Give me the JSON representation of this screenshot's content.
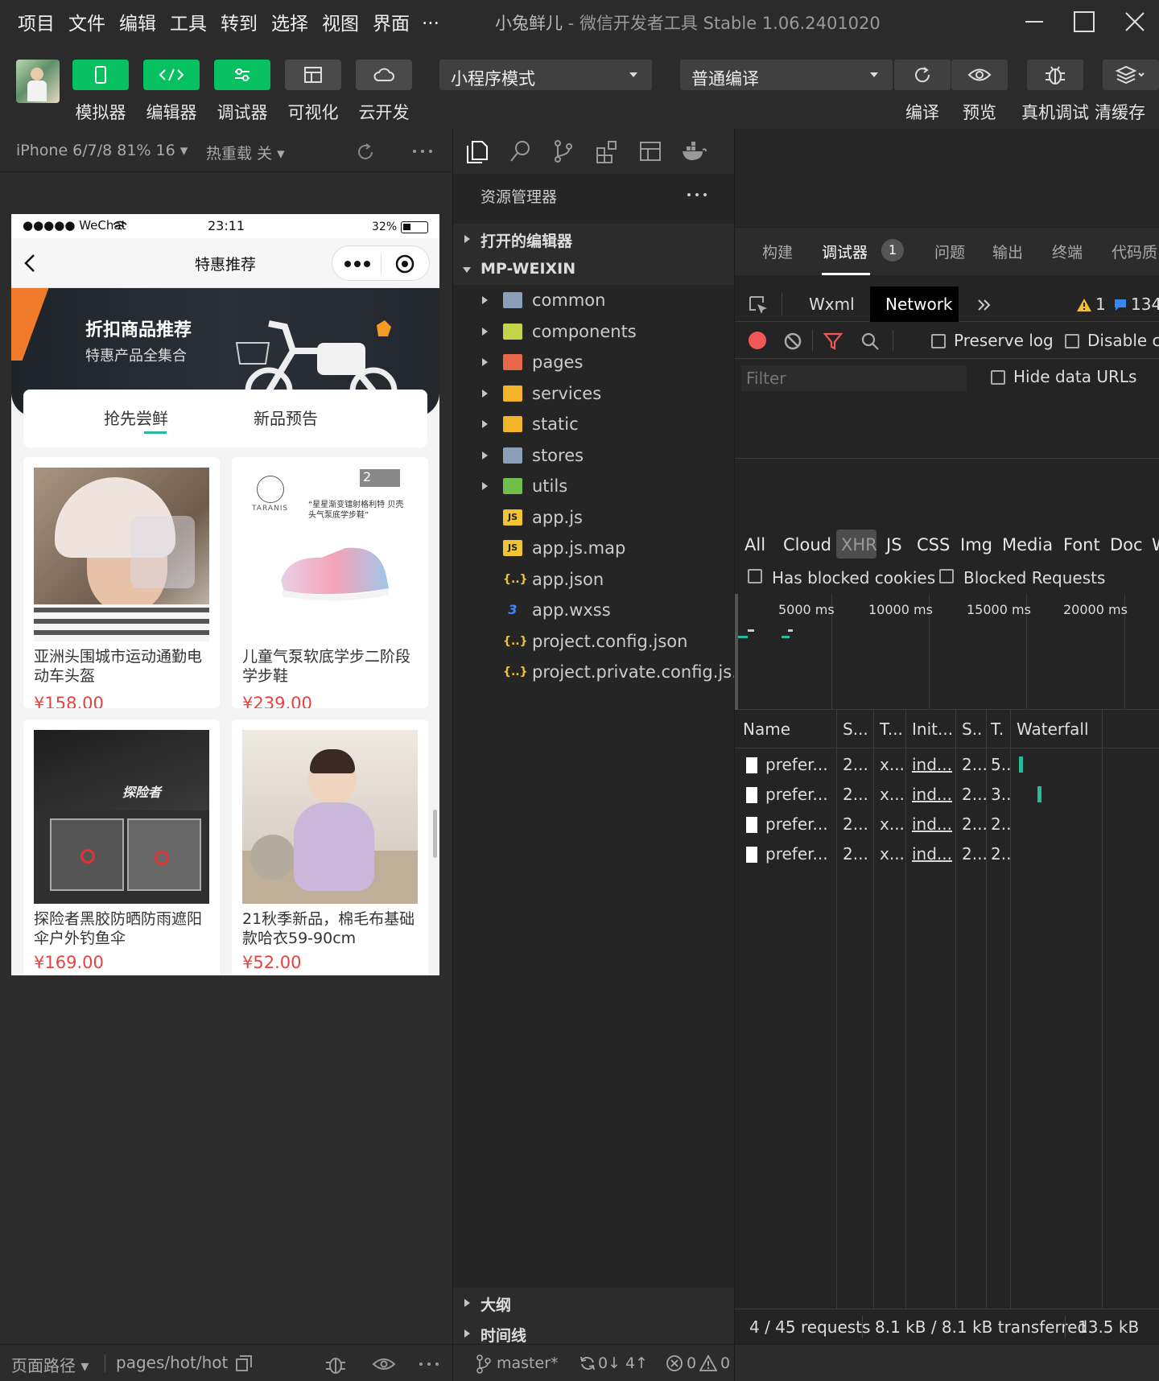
{
  "menu": [
    "项目",
    "文件",
    "编辑",
    "工具",
    "转到",
    "选择",
    "视图",
    "界面",
    "..."
  ],
  "window_title": {
    "app": "小兔鲜儿",
    "sep": " - ",
    "rest": "微信开发者工具 Stable 1.06.2401020"
  },
  "toolbar": {
    "simulator": "模拟器",
    "editor": "编辑器",
    "debugger": "调试器",
    "visual": "可视化",
    "cloud": "云开发",
    "mode_select": "小程序模式",
    "compile_select": "普通编译",
    "compile": "编译",
    "preview": "预览",
    "real_debug": "真机调试",
    "clear_cache": "清缓存"
  },
  "sim_bar": {
    "device": "iPhone 6/7/8 81% 16 ▾",
    "hot_reload": "热重载 关 ▾"
  },
  "phone": {
    "carrier": "●●●●● WeChat",
    "time": "23:11",
    "battery": "32%",
    "nav_title": "特惠推荐",
    "banner_title": "折扣商品推荐",
    "banner_sub": "特惠产品全集合",
    "tabs": [
      "抢先尝鲜",
      "新品预告"
    ],
    "products": [
      {
        "name": "亚洲头围城市运动通勤电动车头盔",
        "price": "¥158.00"
      },
      {
        "name": "儿童气泵软底学步二阶段学步鞋",
        "price": "¥239.00"
      },
      {
        "name": "探险者黑胶防晒防雨遮阳伞户外钓鱼伞",
        "price": "¥169.00"
      },
      {
        "name": "21秋季新品，棉毛布基础款哈衣59-90cm",
        "price": "¥52.00"
      }
    ],
    "shoe_brand": "TARANIS",
    "shoe_badge": "2",
    "shoe_slogan": "“星星渐变镭射格利特 贝壳头气泵底学步鞋”",
    "umbrella_brand": "探险者"
  },
  "sim_bottom": {
    "path_label": "页面路径 ▾",
    "path": "pages/hot/hot"
  },
  "explorer": {
    "title": "资源管理器",
    "open_editors": "打开的编辑器",
    "root": "MP-WEIXIN",
    "items": [
      {
        "name": "common",
        "kind": "folder",
        "color": "#8a9fb8"
      },
      {
        "name": "components",
        "kind": "folder",
        "color": "#c3d44a"
      },
      {
        "name": "pages",
        "kind": "folder",
        "color": "#e8684a"
      },
      {
        "name": "services",
        "kind": "folder",
        "color": "#f3b32a"
      },
      {
        "name": "static",
        "kind": "folder",
        "color": "#f3b32a"
      },
      {
        "name": "stores",
        "kind": "folder",
        "color": "#8a9fb8"
      },
      {
        "name": "utils",
        "kind": "folder",
        "color": "#6fbf4a"
      },
      {
        "name": "app.js",
        "kind": "js"
      },
      {
        "name": "app.js.map",
        "kind": "js"
      },
      {
        "name": "app.json",
        "kind": "json"
      },
      {
        "name": "app.wxss",
        "kind": "css"
      },
      {
        "name": "project.config.json",
        "kind": "json"
      },
      {
        "name": "project.private.config.js...",
        "kind": "json"
      }
    ],
    "outline": "大纲",
    "timeline": "时间线",
    "branch": "master*",
    "sync": "0↓ 4↑",
    "errors": "0",
    "warnings": "0"
  },
  "devtools": {
    "top_tabs": [
      "构建",
      "调试器",
      "问题",
      "输出",
      "终端",
      "代码质"
    ],
    "debugger_badge": "1",
    "panel_tabs": {
      "wxml": "Wxml",
      "network": "Network"
    },
    "warn_count": "1",
    "msg_count": "134",
    "preserve_log": "Preserve log",
    "disable_cache": "Disable ca",
    "filter_placeholder": "Filter",
    "hide_data_urls": "Hide data URLs",
    "types": [
      "All",
      "Cloud",
      "XHR",
      "JS",
      "CSS",
      "Img",
      "Media",
      "Font",
      "Doc",
      "W"
    ],
    "has_blocked_cookies": "Has blocked cookies",
    "blocked_requests": "Blocked Requests",
    "timeline_ticks": [
      "5000 ms",
      "10000 ms",
      "15000 ms",
      "20000 ms"
    ],
    "columns": [
      "Name",
      "S...",
      "T...",
      "Init...",
      "S..",
      "T.",
      "Waterfall"
    ],
    "rows": [
      {
        "name": "prefer...",
        "status": "2...",
        "type": "x...",
        "init": "ind...",
        "size": "2...",
        "time": "5.."
      },
      {
        "name": "prefer...",
        "status": "2...",
        "type": "x...",
        "init": "ind...",
        "size": "2...",
        "time": "3.."
      },
      {
        "name": "prefer...",
        "status": "2...",
        "type": "x...",
        "init": "ind...",
        "size": "2...",
        "time": "2.."
      },
      {
        "name": "prefer...",
        "status": "2...",
        "type": "x...",
        "init": "ind...",
        "size": "2...",
        "time": "2.."
      }
    ],
    "footer": {
      "requests": "4 / 45 requests",
      "transferred": "8.1 kB / 8.1 kB transferred",
      "resources": "13.5 kB"
    }
  }
}
